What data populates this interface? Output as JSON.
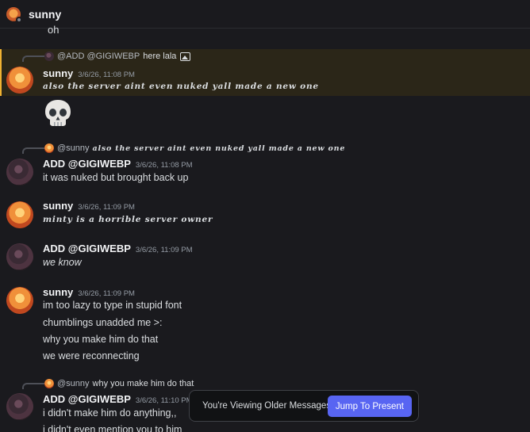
{
  "header": {
    "title": "sunny"
  },
  "fragment": "oh",
  "messages": [
    {
      "reply": {
        "author": "@ADD @GIGIWEBP",
        "text": "here lala",
        "has_image": true
      },
      "author": "sunny",
      "time": "3/6/26, 11:08 PM",
      "lines": [
        "also the server aint even nuked yall made a new one"
      ],
      "emoji": "skull-emoji"
    },
    {
      "reply": {
        "author": "@sunny",
        "text": "also the server aint even nuked yall made a new one"
      },
      "author": "ADD @GIGIWEBP",
      "time": "3/6/26, 11:08 PM",
      "lines": [
        "it was nuked but brought back up"
      ]
    },
    {
      "author": "sunny",
      "time": "3/6/26, 11:09 PM",
      "lines": [
        "minty is a horrible server owner"
      ]
    },
    {
      "author": "ADD @GIGIWEBP",
      "time": "3/6/26, 11:09 PM",
      "lines": [
        "we know"
      ]
    },
    {
      "author": "sunny",
      "time": "3/6/26, 11:09 PM",
      "lines": [
        "im too lazy to type in stupid font",
        "chumblings unadded me >:",
        "why you make him do that",
        "we were reconnecting"
      ]
    },
    {
      "reply": {
        "author": "@sunny",
        "text": "why you make him do that"
      },
      "author": "ADD @GIGIWEBP",
      "time": "3/6/26, 11:10 PM",
      "lines": [
        "i didn't make him do anything,,",
        "i didn't even mention you to him"
      ]
    }
  ],
  "toast": {
    "message": "You're Viewing Older Messages",
    "button": "Jump To Present"
  },
  "colors": {
    "accent": "#5865f2",
    "highlight_bar": "#f0b232",
    "background": "#1a1a1e"
  }
}
